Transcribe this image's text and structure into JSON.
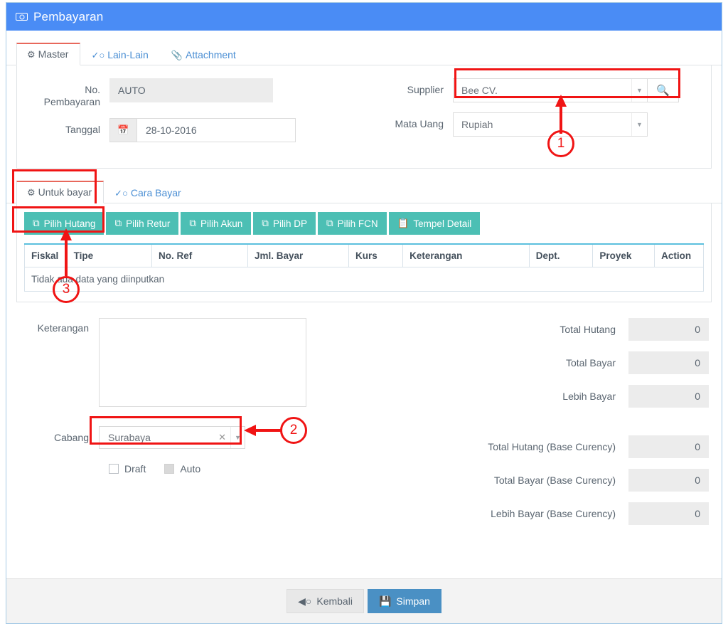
{
  "window": {
    "title": "Pembayaran",
    "title_icon": "money-bill-icon",
    "header_color": "#4a8cf5",
    "accent_teal": "#4cbfb4",
    "accent_blue": "#4a90c4",
    "annotation_color": "#f01414"
  },
  "main_tabs": [
    {
      "label": "Master",
      "icon": "cogs-icon",
      "active": true
    },
    {
      "label": "Lain-Lain",
      "icon": "check-circle-icon",
      "active": false
    },
    {
      "label": "Attachment",
      "icon": "paperclip-icon",
      "active": false
    }
  ],
  "master": {
    "no_pembayaran": {
      "label_line1": "No.",
      "label_line2": "Pembayaran",
      "value": "AUTO"
    },
    "tanggal": {
      "label": "Tanggal",
      "value": "28-10-2016",
      "icon": "calendar-icon"
    },
    "supplier": {
      "label": "Supplier",
      "value": "Bee CV.",
      "search_icon": "search-icon",
      "caret_icon": "chevron-down-icon"
    },
    "mata_uang": {
      "label": "Mata Uang",
      "value": "Rupiah",
      "caret_icon": "chevron-down-icon"
    }
  },
  "detail_tabs": [
    {
      "label": "Untuk bayar",
      "icon": "cogs-icon",
      "active": true
    },
    {
      "label": "Cara Bayar",
      "icon": "check-circle-icon",
      "active": false
    }
  ],
  "toolbar_buttons": [
    {
      "label": "Pilih Hutang",
      "icon": "clone-icon"
    },
    {
      "label": "Pilih Retur",
      "icon": "clone-icon"
    },
    {
      "label": "Pilih Akun",
      "icon": "clone-icon"
    },
    {
      "label": "Pilih DP",
      "icon": "clone-icon"
    },
    {
      "label": "Pilih FCN",
      "icon": "clone-icon"
    },
    {
      "label": "Tempel Detail",
      "icon": "paste-icon"
    }
  ],
  "grid": {
    "columns": [
      "Fiskal",
      "Tipe",
      "No. Ref",
      "Jml. Bayar",
      "Kurs",
      "Keterangan",
      "Dept.",
      "Proyek",
      "Action"
    ],
    "rows": [],
    "empty_message": "Tidak ada data yang diinputkan"
  },
  "lower": {
    "keterangan": {
      "label": "Keterangan",
      "value": "",
      "placeholder": ""
    },
    "cabang": {
      "label": "Cabang",
      "value": "Surabaya",
      "clear_icon": "close-icon",
      "caret_icon": "chevron-down-icon"
    },
    "draft": {
      "label": "Draft",
      "checked": false,
      "disabled": false
    },
    "auto": {
      "label": "Auto",
      "checked": false,
      "disabled": true
    }
  },
  "totals": [
    {
      "label": "Total Hutang",
      "value": "0"
    },
    {
      "label": "Total Bayar",
      "value": "0"
    },
    {
      "label": "Lebih Bayar",
      "value": "0"
    },
    {
      "label": "Total Hutang (Base Curency)",
      "value": "0"
    },
    {
      "label": "Total Bayar (Base Curency)",
      "value": "0"
    },
    {
      "label": "Lebih Bayar (Base Curency)",
      "value": "0"
    }
  ],
  "footer": {
    "back": {
      "label": "Kembali",
      "icon": "arrow-circle-left-icon"
    },
    "save": {
      "label": "Simpan",
      "icon": "floppy-disk-icon"
    }
  },
  "annotations": [
    {
      "number": "1",
      "target": "supplier-field"
    },
    {
      "number": "2",
      "target": "cabang-field"
    },
    {
      "number": "3",
      "target": "pilih-hutang-button"
    }
  ]
}
